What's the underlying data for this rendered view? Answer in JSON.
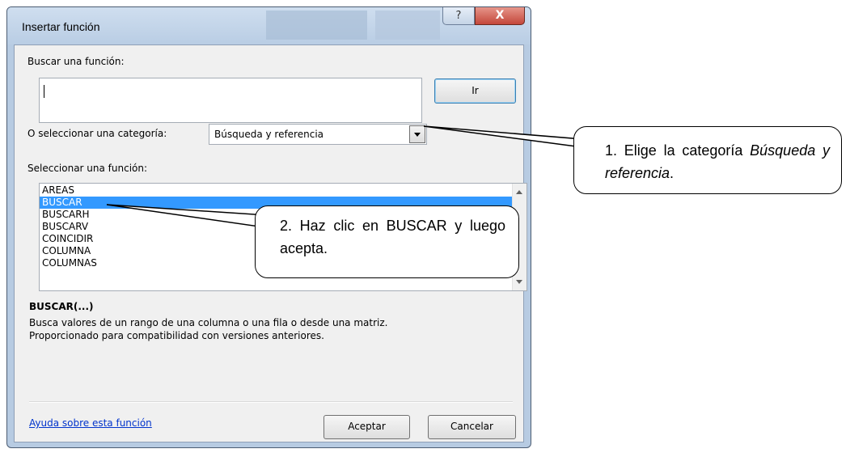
{
  "window": {
    "title": "Insertar función",
    "help_label": "?",
    "close_label": "X"
  },
  "search": {
    "label": "Buscar una función:",
    "value": "",
    "go_label": "Ir"
  },
  "category": {
    "label": "O seleccionar una categoría:",
    "selected": "Búsqueda y referencia"
  },
  "functions": {
    "label": "Seleccionar una función:",
    "items": [
      "AREAS",
      "BUSCAR",
      "BUSCARH",
      "BUSCARV",
      "COINCIDIR",
      "COLUMNA",
      "COLUMNAS"
    ],
    "selected_index": 1
  },
  "details": {
    "signature": "BUSCAR(...)",
    "desc_line1": "Busca valores de un rango de una columna o una fila o desde una matriz.",
    "desc_line2": "Proporcionado para compatibilidad con versiones anteriores."
  },
  "footer": {
    "help_link": "Ayuda sobre esta función",
    "ok_label": "Aceptar",
    "cancel_label": "Cancelar"
  },
  "callouts": {
    "c1_text_a": "1. Elige la categoría ",
    "c1_text_italic": "Búsqueda y referencia",
    "c1_text_b": ".",
    "c2_text": "2. Haz clic en BUSCAR y luego acepta."
  },
  "colors": {
    "selection": "#3399ff",
    "link": "#0033cc",
    "close_button": "#c4473a"
  }
}
